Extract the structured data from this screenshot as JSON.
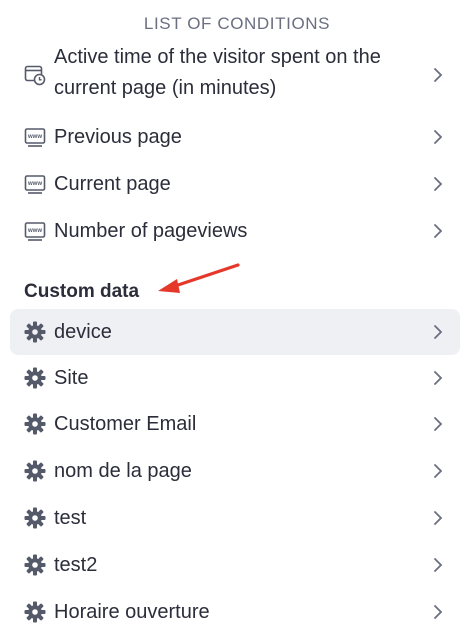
{
  "header": {
    "title": "LIST OF CONDITIONS"
  },
  "items": [
    {
      "label_line1": "Active time of the visitor spent on the",
      "label_line2": "current page (in minutes)",
      "icon": "calendar-clock-icon"
    },
    {
      "label": "Previous page",
      "icon": "www-icon"
    },
    {
      "label": "Current page",
      "icon": "www-icon"
    },
    {
      "label": "Number of pageviews",
      "icon": "www-icon"
    }
  ],
  "section": {
    "title": "Custom data"
  },
  "custom_items": [
    {
      "label": "device",
      "icon": "gear-icon",
      "active": true
    },
    {
      "label": "Site",
      "icon": "gear-icon"
    },
    {
      "label": "Customer Email",
      "icon": "gear-icon"
    },
    {
      "label": "nom de la page",
      "icon": "gear-icon"
    },
    {
      "label": "test",
      "icon": "gear-icon"
    },
    {
      "label": "test2",
      "icon": "gear-icon"
    },
    {
      "label": "Horaire ouverture",
      "icon": "gear-icon"
    }
  ],
  "colors": {
    "accent_arrow": "#e5382a",
    "active_bg": "#eef0f4",
    "text": "#2b2d3a",
    "header": "#6a6e80"
  }
}
